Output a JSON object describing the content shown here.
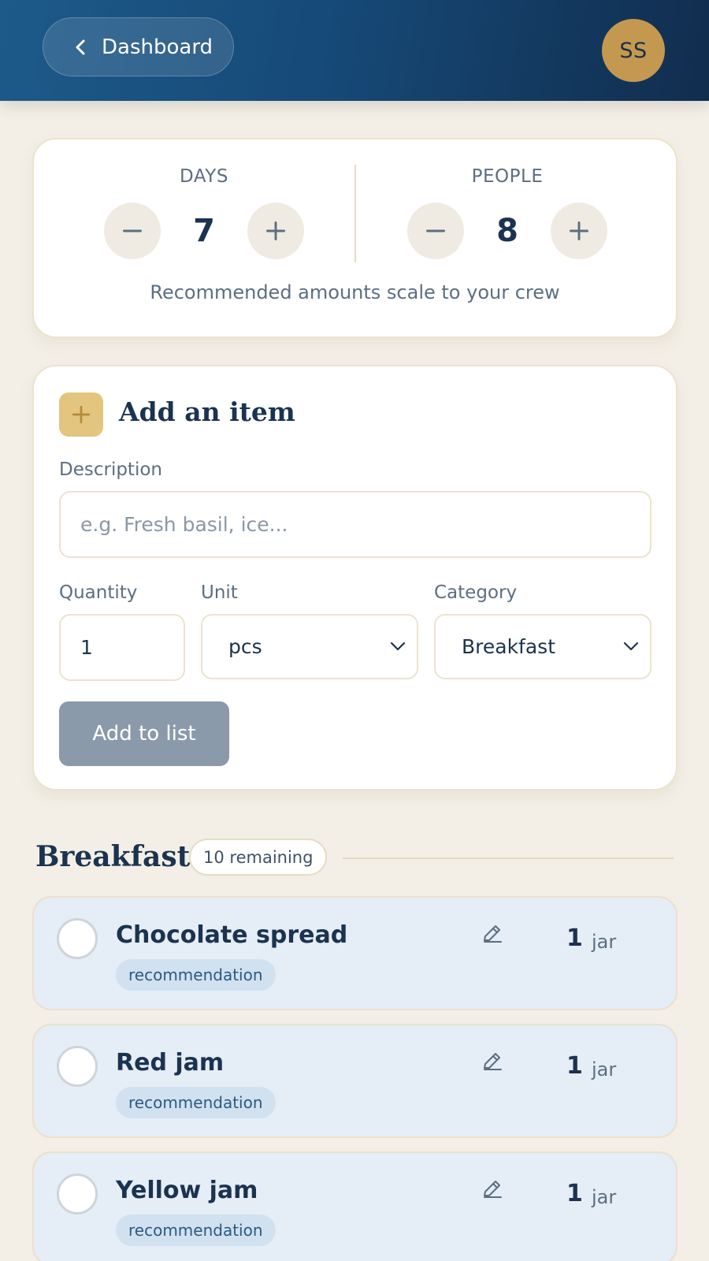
{
  "header": {
    "back_label": "Dashboard",
    "avatar_initials": "SS"
  },
  "stepper": {
    "days_label": "DAYS",
    "days_value": "7",
    "people_label": "PEOPLE",
    "people_value": "8",
    "hint": "Recommended amounts scale to your crew"
  },
  "add_item": {
    "title": "Add an item",
    "description_label": "Description",
    "description_placeholder": "e.g. Fresh basil, ice...",
    "quantity_label": "Quantity",
    "quantity_value": "1",
    "unit_label": "Unit",
    "unit_value": "pcs",
    "category_label": "Category",
    "category_value": "Breakfast",
    "submit_label": "Add to list"
  },
  "section": {
    "title": "Breakfast",
    "remaining": "10 remaining",
    "items": [
      {
        "name": "Chocolate spread",
        "tag": "recommendation",
        "qty": "1",
        "unit": "jar"
      },
      {
        "name": "Red jam",
        "tag": "recommendation",
        "qty": "1",
        "unit": "jar"
      },
      {
        "name": "Yellow jam",
        "tag": "recommendation",
        "qty": "1",
        "unit": "jar"
      }
    ]
  },
  "colors": {
    "header_start": "#1d5a8a",
    "header_end": "#112d4e",
    "accent_gold": "#c4994f",
    "item_bg": "#e5edf7",
    "page_bg": "#f3efe6"
  }
}
